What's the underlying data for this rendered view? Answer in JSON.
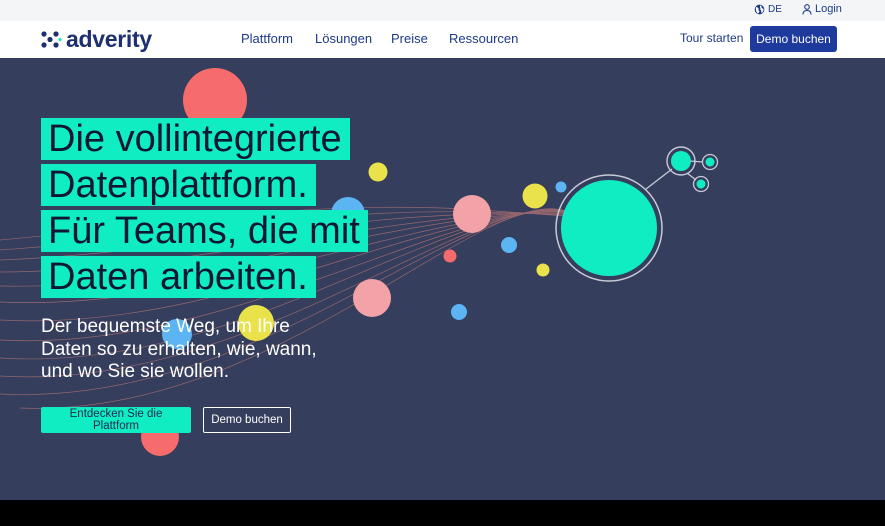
{
  "topbar": {
    "language": "DE",
    "login": "Login"
  },
  "nav": {
    "logo_text": "adverity",
    "items": [
      {
        "label": "Plattform"
      },
      {
        "label": "Lösungen"
      },
      {
        "label": "Preise"
      },
      {
        "label": "Ressourcen"
      }
    ],
    "tour_label": "Tour starten",
    "demo_label": "Demo buchen"
  },
  "hero": {
    "headline": [
      "Die vollintegrierte",
      "Datenplattform.",
      "Für Teams, die mit",
      "Daten arbeiten."
    ],
    "subline": [
      "Der bequemste Weg, um Ihre",
      "Daten so zu erhalten, wie, wann,",
      "und wo Sie sie wollen."
    ],
    "primary_cta": "Entdecken Sie die Plattform",
    "secondary_cta": "Demo buchen"
  },
  "colors": {
    "brand_navy": "#1d2f6f",
    "accent_teal": "#11edc3",
    "hero_bg": "#353e5c",
    "button_blue": "#1d3a9c"
  },
  "icons": {
    "language": "globe-icon",
    "login": "user-icon",
    "logo": "adverity-mark-icon"
  }
}
